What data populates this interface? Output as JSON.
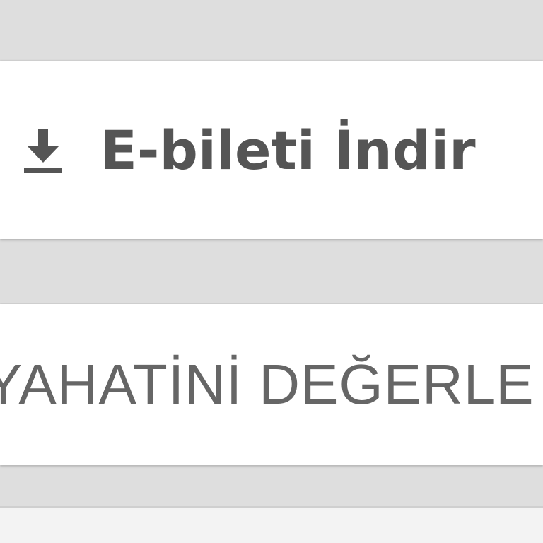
{
  "actions": {
    "download_label": "E-bileti İndir",
    "download_icon": "download-icon",
    "review_label": "YAHATİNİ DEĞERLE"
  },
  "colors": {
    "background": "#dedede",
    "card": "#ffffff",
    "text_primary": "#555555",
    "text_secondary": "#666666"
  }
}
